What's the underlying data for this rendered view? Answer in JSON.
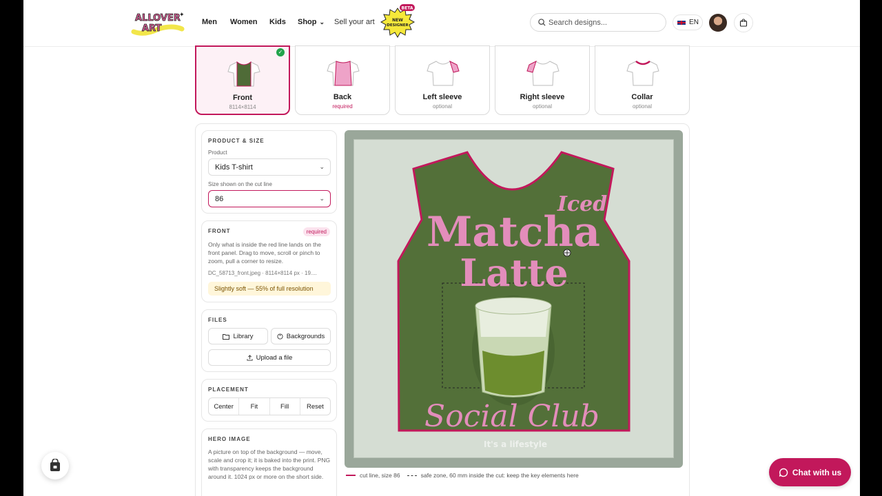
{
  "brand": {
    "logo_text": "ALLOVER ART",
    "badge_top": "BETA",
    "badge_text": "NEW DESIGNER"
  },
  "nav": {
    "men": "Men",
    "women": "Women",
    "kids": "Kids",
    "shop": "Shop",
    "sell": "Sell your art"
  },
  "search": {
    "placeholder": "Search designs..."
  },
  "lang": {
    "label": "EN"
  },
  "panels": [
    {
      "label": "Front",
      "sub": "8114×8114",
      "selected": true
    },
    {
      "label": "Back",
      "sub": "required",
      "selected": false
    },
    {
      "label": "Left sleeve",
      "sub": "optional",
      "selected": false
    },
    {
      "label": "Right sleeve",
      "sub": "optional",
      "selected": false
    },
    {
      "label": "Collar",
      "sub": "optional",
      "selected": false
    }
  ],
  "product": {
    "title": "PRODUCT & SIZE",
    "product_label": "Product",
    "product_value": "Kids T-shirt",
    "size_label": "Size shown on the cut line",
    "size_value": "86"
  },
  "front": {
    "title": "FRONT",
    "pill": "required",
    "desc": "Only what is inside the red line lands on the front panel. Drag to move, scroll or pinch to zoom, pull a corner to resize.",
    "file": "DC_58713_front.jpeg · 8114×8114 px · 19....",
    "warning": "Slightly soft — 55% of full resolution"
  },
  "files": {
    "title": "FILES",
    "library": "Library",
    "backgrounds": "Backgrounds",
    "upload": "Upload a file"
  },
  "placement": {
    "title": "PLACEMENT",
    "center": "Center",
    "fit": "Fit",
    "fill": "Fill",
    "reset": "Reset"
  },
  "hero": {
    "title": "HERO IMAGE",
    "desc": "A picture on top of the background — move, scale and crop it; it is baked into the print. PNG with transparency keeps the background around it. 1024 px or more on the short side."
  },
  "artwork": {
    "line1": "Iced",
    "line2": "Matcha",
    "line3": "Latte",
    "line4": "Social Club",
    "line5": "It's a lifestyle"
  },
  "legend": {
    "cut": "cut line, size 86",
    "safe": "safe zone, 60 mm inside the cut: keep the key elements here"
  },
  "chat": {
    "label": "Chat with us"
  },
  "colors": {
    "accent": "#c2185b",
    "shirt": "#4f6b37",
    "art_pink": "#e38dbb"
  }
}
